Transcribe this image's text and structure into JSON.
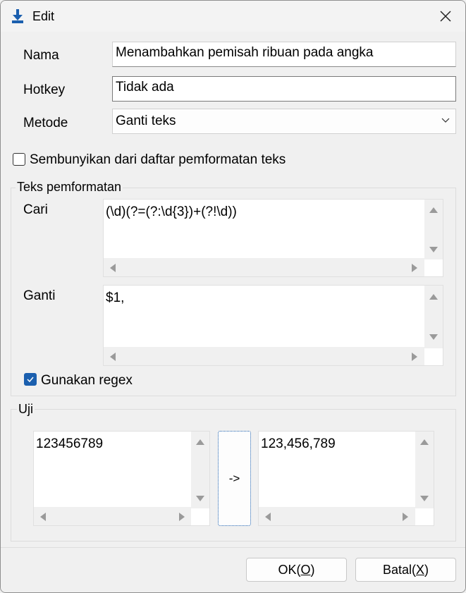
{
  "window": {
    "title": "Edit"
  },
  "form": {
    "nama_label": "Nama",
    "nama_value": "Menambahkan pemisah ribuan pada angka",
    "hotkey_label": "Hotkey",
    "hotkey_value": "Tidak ada",
    "metode_label": "Metode",
    "metode_value": "Ganti teks",
    "hide_checkbox_label": "Sembunyikan dari daftar pemformatan teks",
    "hide_checked": false
  },
  "formatting": {
    "group_title": "Teks pemformatan",
    "cari_label": "Cari",
    "cari_value": "(\\d)(?=(?:\\d{3})+(?!\\d))",
    "ganti_label": "Ganti",
    "ganti_value": "$1,",
    "regex_label": "Gunakan regex",
    "regex_checked": true
  },
  "test": {
    "group_title": "Uji",
    "input_value": "123456789",
    "run_button": "->",
    "output_value": "123,456,789"
  },
  "footer": {
    "ok_text": "OK(",
    "ok_key": "O",
    "ok_end": ")",
    "cancel_text": "Batal(",
    "cancel_key": "X",
    "cancel_end": ")"
  },
  "icons": {
    "app": "download-arrow-icon",
    "close": "close-icon",
    "dropdown": "chevron-down-icon",
    "check": "checkmark-icon"
  },
  "colors": {
    "accent": "#1b5fae"
  }
}
